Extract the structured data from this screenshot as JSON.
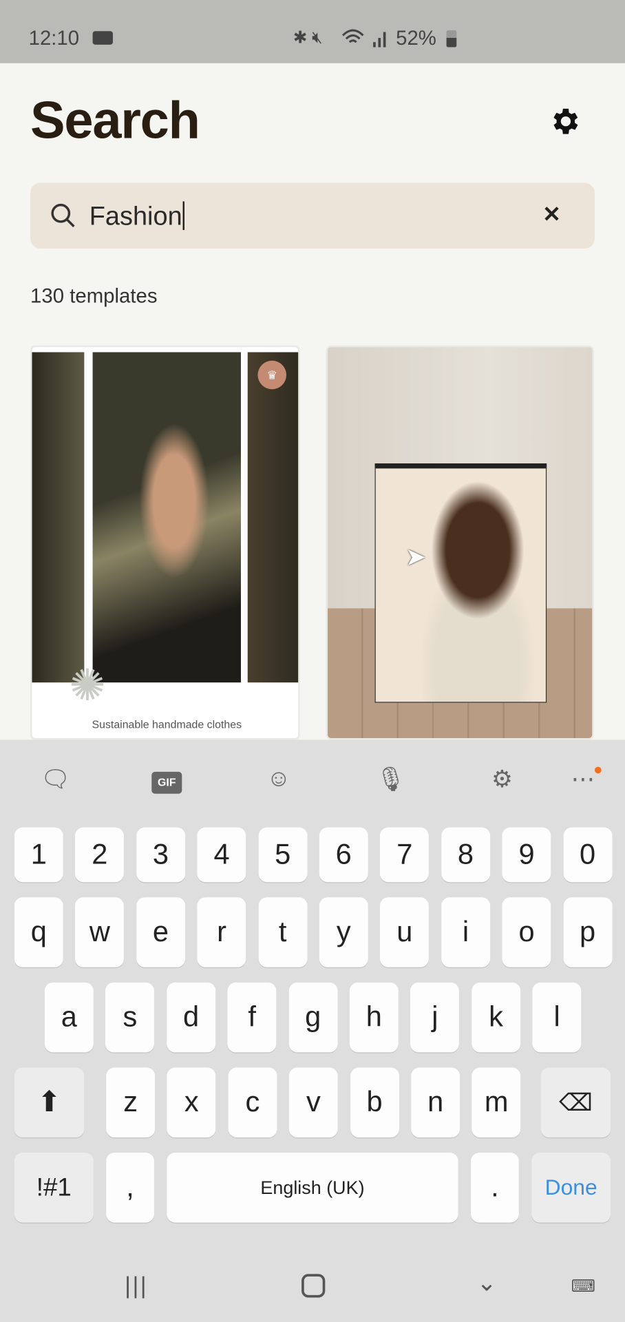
{
  "status_bar": {
    "time": "12:10",
    "battery": "52%",
    "icons": [
      "video-record-icon",
      "bluetooth-icon",
      "mute-icon",
      "wifi-icon",
      "signal-icon",
      "battery-icon"
    ]
  },
  "header": {
    "title": "Search",
    "settings_icon": "gear-icon"
  },
  "search": {
    "value": "Fashion",
    "clear_icon": "close-icon"
  },
  "results": {
    "count_label": "130 templates"
  },
  "cards": [
    {
      "caption": "Sustainable handmade clothes",
      "premium_badge": "crown-icon"
    },
    {
      "caption": ""
    }
  ],
  "keyboard": {
    "toolbar": [
      "sticker-icon",
      "GIF",
      "emoji-icon",
      "mic-icon",
      "gear-icon",
      "more-icon"
    ],
    "numbers": [
      "1",
      "2",
      "3",
      "4",
      "5",
      "6",
      "7",
      "8",
      "9",
      "0"
    ],
    "row1": [
      "q",
      "w",
      "e",
      "r",
      "t",
      "y",
      "u",
      "i",
      "o",
      "p"
    ],
    "row2": [
      "a",
      "s",
      "d",
      "f",
      "g",
      "h",
      "j",
      "k",
      "l"
    ],
    "row3": [
      "z",
      "x",
      "c",
      "v",
      "b",
      "n",
      "m"
    ],
    "symbols": "!#1",
    "comma": ",",
    "space": "English (UK)",
    "period": ".",
    "done": "Done",
    "accent": "#3d8fe0"
  },
  "nav": [
    "recent-apps-icon",
    "home-icon",
    "back-icon",
    "keyboard-icon"
  ]
}
